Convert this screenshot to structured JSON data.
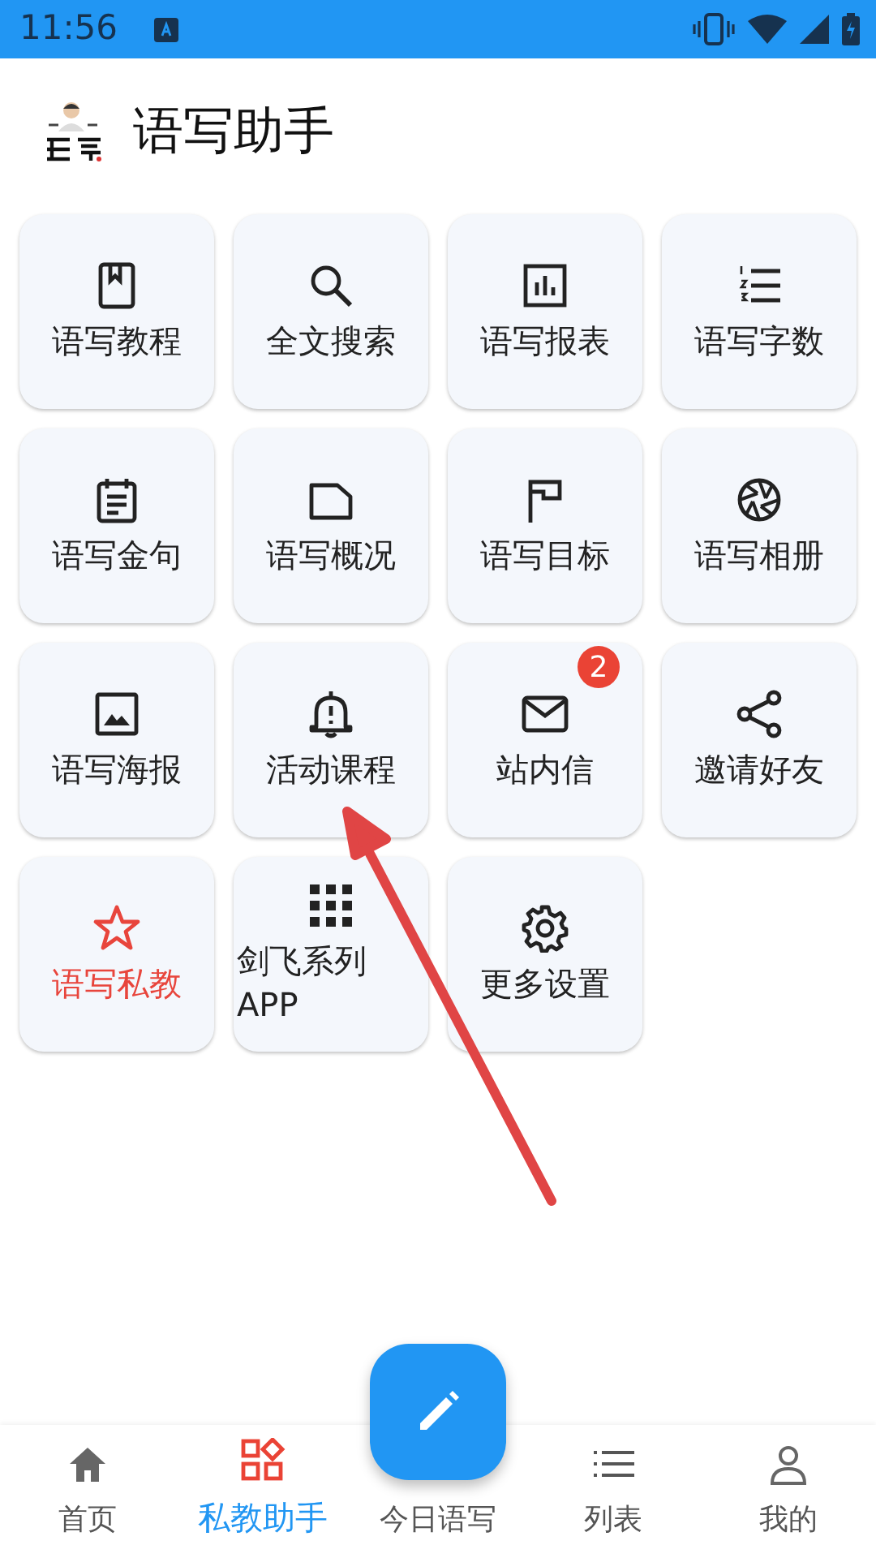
{
  "status_bar": {
    "time": "11:56"
  },
  "header": {
    "title": "语写助手"
  },
  "tiles": [
    {
      "label": "语写教程",
      "highlight": false
    },
    {
      "label": "全文搜索",
      "highlight": false
    },
    {
      "label": "语写报表",
      "highlight": false
    },
    {
      "label": "语写字数",
      "highlight": false
    },
    {
      "label": "语写金句",
      "highlight": false
    },
    {
      "label": "语写概况",
      "highlight": false
    },
    {
      "label": "语写目标",
      "highlight": false
    },
    {
      "label": "语写相册",
      "highlight": false
    },
    {
      "label": "语写海报",
      "highlight": false
    },
    {
      "label": "活动课程",
      "highlight": false
    },
    {
      "label": "站内信",
      "highlight": false,
      "badge": "2"
    },
    {
      "label": "邀请好友",
      "highlight": false
    },
    {
      "label": "语写私教",
      "highlight": true
    },
    {
      "label": "剑飞系列APP",
      "highlight": false
    },
    {
      "label": "更多设置",
      "highlight": false
    }
  ],
  "bottom_nav": [
    {
      "label": "首页",
      "selected": false
    },
    {
      "label": "私教助手",
      "selected": true
    },
    {
      "label": "今日语写",
      "selected": false,
      "kind": "fab"
    },
    {
      "label": "列表",
      "selected": false
    },
    {
      "label": "我的",
      "selected": false
    }
  ]
}
